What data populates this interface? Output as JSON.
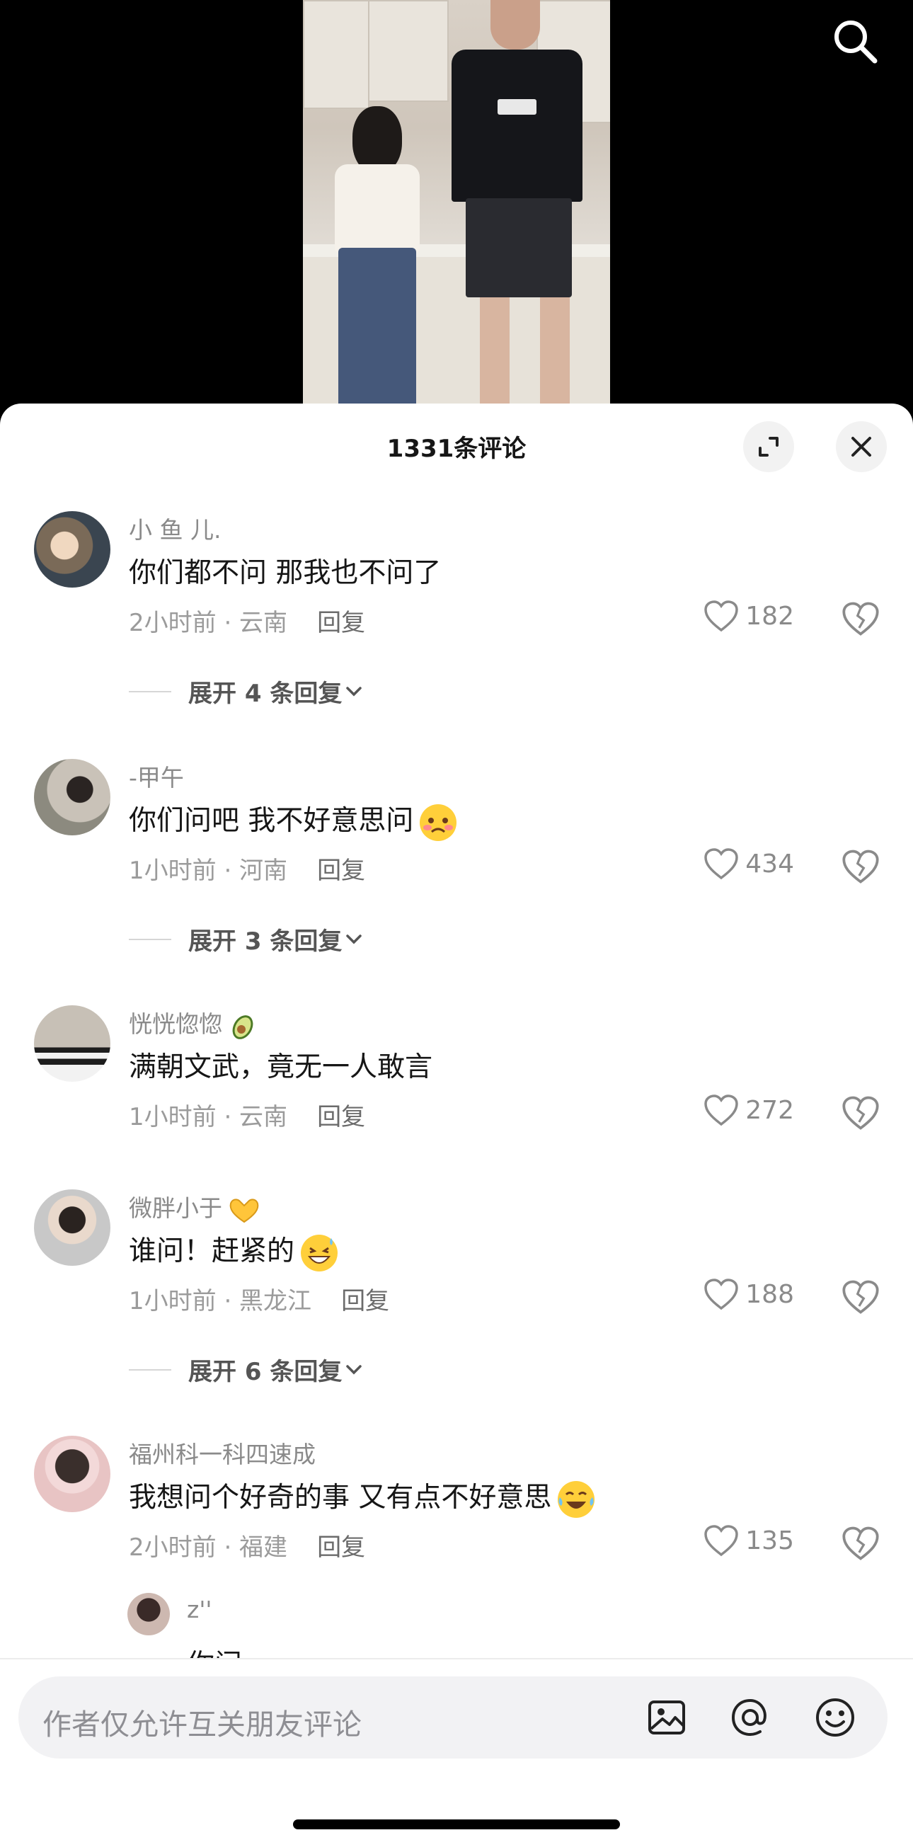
{
  "sheet": {
    "title": "1331条评论",
    "expand_icon": "expand-icon",
    "close_icon": "close-icon"
  },
  "video": {
    "search_icon": "search-icon"
  },
  "comments": [
    {
      "username": "小 鱼 儿.",
      "text": "你们都不问 那我也不问了",
      "time_loc": "2小时前 · 云南",
      "reply": "回复",
      "likes": "182",
      "expand": "展开 4 条回复"
    },
    {
      "username": "-甲午",
      "text": "你们问吧 我不好意思问",
      "time_loc": "1小时前 · 河南",
      "reply": "回复",
      "likes": "434",
      "expand": "展开 3 条回复"
    },
    {
      "username": "恍恍惚惚",
      "text": "满朝文武，竟无一人敢言",
      "time_loc": "1小时前 · 云南",
      "reply": "回复",
      "likes": "272"
    },
    {
      "username": "微胖小于",
      "text": "谁问！赶紧的",
      "time_loc": "1小时前 · 黑龙江",
      "reply": "回复",
      "likes": "188",
      "expand": "展开 6 条回复"
    },
    {
      "username": "福州科一科四速成",
      "text": "我想问个好奇的事 又有点不好意思",
      "time_loc": "2小时前 · 福建",
      "reply": "回复",
      "likes": "135"
    }
  ],
  "sub_reply": {
    "username": "z''",
    "text": "你问"
  },
  "input": {
    "placeholder": "作者仅允许互关朋友评论",
    "image_icon": "image-icon",
    "at_icon": "at-icon",
    "emoji_icon": "emoji-icon"
  }
}
